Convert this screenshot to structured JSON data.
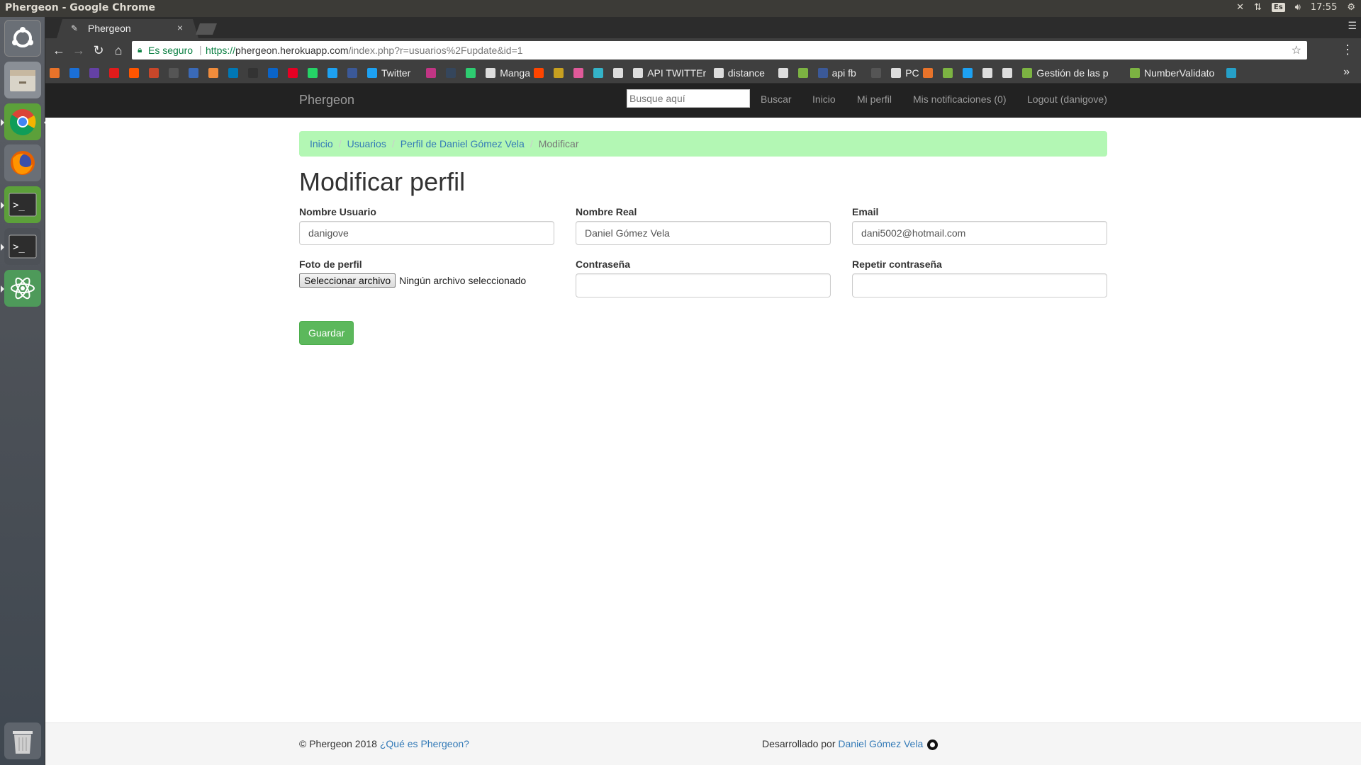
{
  "os": {
    "window_title": "Phergeon - Google Chrome",
    "keyboard_layout": "Es",
    "clock": "17:55"
  },
  "launcher": {
    "items": [
      "ubuntu-dash-icon",
      "files-icon",
      "chrome-icon",
      "firefox-icon",
      "terminal-icon",
      "terminal-2-icon",
      "atom-icon",
      "trash-icon"
    ]
  },
  "browser": {
    "tab_title": "Phergeon",
    "tab_close": "×",
    "secure_label": "Es seguro",
    "url_scheme": "https://",
    "url_host": "phergeon.herokuapp.com",
    "url_rest": "/index.php?r=usuarios%2Fupdate&id=1",
    "bookmarks": [
      {
        "label": "",
        "color": "#e8732a"
      },
      {
        "label": "",
        "color": "#1b6fd6"
      },
      {
        "label": "",
        "color": "#6441a5"
      },
      {
        "label": "",
        "color": "#e01b1b"
      },
      {
        "label": "",
        "color": "#ff5500"
      },
      {
        "label": "",
        "color": "#c8472a"
      },
      {
        "label": "",
        "color": "#555555"
      },
      {
        "label": "",
        "color": "#3a6ab8"
      },
      {
        "label": "",
        "color": "#f08c3c"
      },
      {
        "label": "",
        "color": "#0077b5"
      },
      {
        "label": "",
        "color": "#333333"
      },
      {
        "label": "",
        "color": "#0a64c8"
      },
      {
        "label": "",
        "color": "#e60023"
      },
      {
        "label": "",
        "color": "#25d366"
      },
      {
        "label": "",
        "color": "#1da1f2"
      },
      {
        "label": "",
        "color": "#3b5998"
      },
      {
        "label": "Twitter",
        "color": "#1da1f2"
      },
      {
        "label": "",
        "color": "#c13584"
      },
      {
        "label": "",
        "color": "#35465c"
      },
      {
        "label": "",
        "color": "#2ecc71"
      },
      {
        "label": "Manga",
        "color": "#dddddd"
      },
      {
        "label": "",
        "color": "#ff4500"
      },
      {
        "label": "",
        "color": "#c8a020"
      },
      {
        "label": "",
        "color": "#e05a9a"
      },
      {
        "label": "",
        "color": "#34b3c8"
      },
      {
        "label": "",
        "color": "#dddddd"
      },
      {
        "label": "API TWITTEr",
        "color": "#dddddd"
      },
      {
        "label": "distance",
        "color": "#dddddd"
      },
      {
        "label": "",
        "color": "#dddddd"
      },
      {
        "label": "",
        "color": "#7cb342"
      },
      {
        "label": "api fb",
        "color": "#3b5998"
      },
      {
        "label": "",
        "color": "#555555"
      },
      {
        "label": "PC",
        "color": "#dddddd"
      },
      {
        "label": "",
        "color": "#e8732a"
      },
      {
        "label": "",
        "color": "#7cb342"
      },
      {
        "label": "",
        "color": "#1da1f2"
      },
      {
        "label": "",
        "color": "#dddddd"
      },
      {
        "label": "",
        "color": "#dddddd"
      },
      {
        "label": "Gestión de las p",
        "color": "#7cb342"
      },
      {
        "label": "NumberValidato",
        "color": "#7cb342"
      },
      {
        "label": "",
        "color": "#26a0c8"
      }
    ],
    "more_bookmarks": "»"
  },
  "navbar": {
    "brand": "Phergeon",
    "search_placeholder": "Busque aquí",
    "search_button": "Buscar",
    "links": [
      "Inicio",
      "Mi perfil",
      "Mis notificaciones (0)",
      "Logout (danigove)"
    ]
  },
  "breadcrumb": {
    "items": [
      "Inicio",
      "Usuarios",
      "Perfil de Daniel Gómez Vela"
    ],
    "active": "Modificar",
    "divider": "/"
  },
  "form": {
    "heading": "Modificar perfil",
    "username_label": "Nombre Usuario",
    "username_value": "danigove",
    "realname_label": "Nombre Real",
    "realname_value": "Daniel Gómez Vela",
    "email_label": "Email",
    "email_value": "dani5002@hotmail.com",
    "photo_label": "Foto de perfil",
    "photo_button": "Seleccionar archivo",
    "photo_status": "Ningún archivo seleccionado",
    "password_label": "Contraseña",
    "password_value": "",
    "repeat_password_label": "Repetir contraseña",
    "repeat_password_value": "",
    "submit_label": "Guardar"
  },
  "footer": {
    "copyright": "© Phergeon 2018",
    "about_link": "¿Qué es Phergeon?",
    "developed_by": "Desarrollado por",
    "author_link": "Daniel Gómez Vela"
  }
}
